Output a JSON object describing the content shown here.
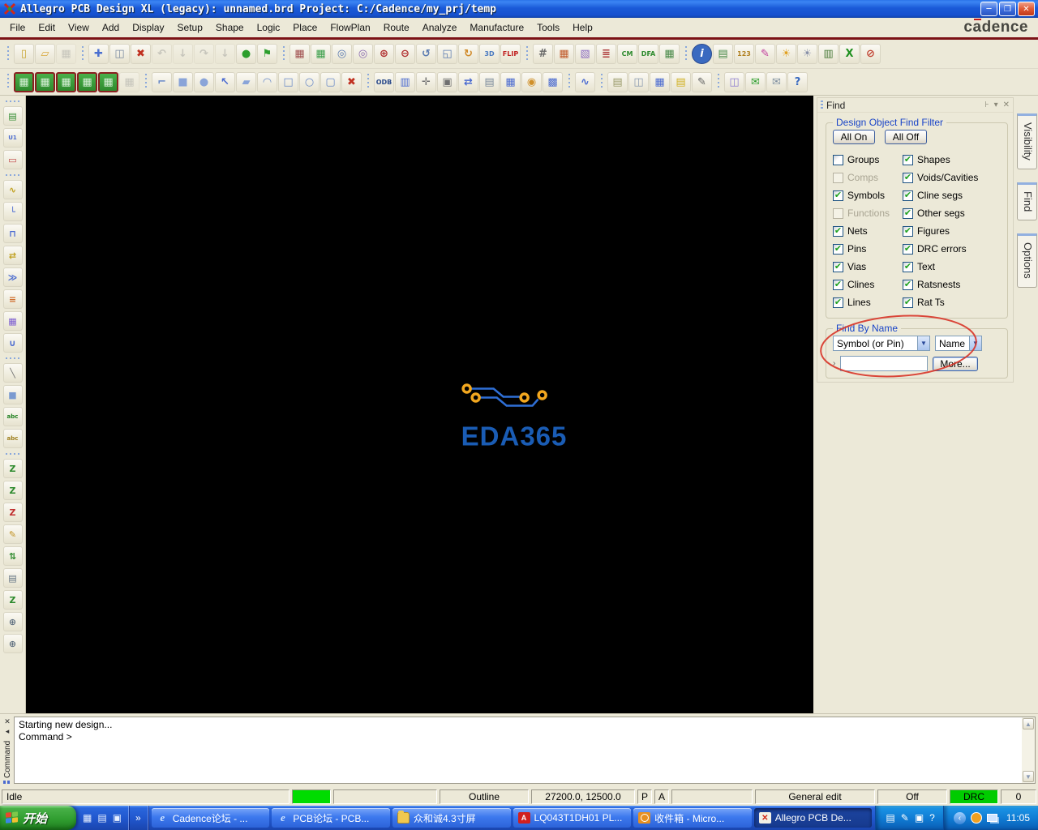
{
  "window": {
    "title": "Allegro PCB Design XL (legacy): unnamed.brd  Project: C:/Cadence/my_prj/temp"
  },
  "menubar": {
    "items": [
      {
        "n": "menu-file",
        "label": "File"
      },
      {
        "n": "menu-edit",
        "label": "Edit"
      },
      {
        "n": "menu-view",
        "label": "View"
      },
      {
        "n": "menu-add",
        "label": "Add"
      },
      {
        "n": "menu-display",
        "label": "Display"
      },
      {
        "n": "menu-setup",
        "label": "Setup"
      },
      {
        "n": "menu-shape",
        "label": "Shape"
      },
      {
        "n": "menu-logic",
        "label": "Logic"
      },
      {
        "n": "menu-place",
        "label": "Place"
      },
      {
        "n": "menu-flowplan",
        "label": "FlowPlan"
      },
      {
        "n": "menu-route",
        "label": "Route"
      },
      {
        "n": "menu-analyze",
        "label": "Analyze"
      },
      {
        "n": "menu-manufacture",
        "label": "Manufacture"
      },
      {
        "n": "menu-tools",
        "label": "Tools"
      },
      {
        "n": "menu-help",
        "label": "Help"
      }
    ],
    "brand": {
      "pre": "c",
      "a": "a",
      "post": "dence"
    }
  },
  "toolbar_top": [
    {
      "sep": true
    },
    {
      "n": "new-file-icon",
      "g": "▯",
      "c": "#c8a430"
    },
    {
      "n": "open-folder-icon",
      "g": "▱",
      "c": "#d8a83a"
    },
    {
      "n": "save-icon",
      "g": "▦",
      "c": "#9a9a9a",
      "cls": "dis"
    },
    {
      "sep": true
    },
    {
      "n": "move-icon",
      "g": "✚",
      "c": "#4a6fd0"
    },
    {
      "n": "copy-icon",
      "g": "◫",
      "c": "#7a8aa0"
    },
    {
      "n": "delete-icon",
      "g": "✖",
      "c": "#c03020"
    },
    {
      "n": "undo-icon",
      "g": "↶",
      "c": "#9a9a9a",
      "cls": "dis"
    },
    {
      "n": "export-icon",
      "g": "↓",
      "c": "#9a9a9a",
      "cls": "dis"
    },
    {
      "n": "redo-icon",
      "g": "↷",
      "c": "#9a9a9a",
      "cls": "dis"
    },
    {
      "n": "import-icon",
      "g": "↓",
      "c": "#9a9a9a",
      "cls": "dis"
    },
    {
      "n": "world-view-icon",
      "g": "●",
      "c": "#2d9e2d"
    },
    {
      "n": "pin-view-icon",
      "g": "⚑",
      "c": "#2d9e2d"
    },
    {
      "sep": true
    },
    {
      "n": "redraw-icon",
      "g": "▦",
      "c": "#a05050"
    },
    {
      "n": "zoom-world-icon",
      "g": "▦",
      "c": "#3a9e4a"
    },
    {
      "n": "zoom-rect-icon",
      "g": "◎",
      "c": "#5a7ab0"
    },
    {
      "n": "zoom-points-icon",
      "g": "◎",
      "c": "#8a6ab0"
    },
    {
      "n": "zoom-in-icon",
      "g": "⊕",
      "c": "#b03030"
    },
    {
      "n": "zoom-out-icon",
      "g": "⊖",
      "c": "#b03030"
    },
    {
      "n": "zoom-previous-icon",
      "g": "↺",
      "c": "#5a7ab0"
    },
    {
      "n": "zoom-fit-icon",
      "g": "◱",
      "c": "#5a7ab0"
    },
    {
      "n": "zoom-redraw-icon",
      "g": "↻",
      "c": "#d08a2a"
    },
    {
      "n": "view-3d-icon",
      "g": "3D",
      "c": "#4a7ac0",
      "cls": "txt"
    },
    {
      "n": "flip-design-icon",
      "g": "FLIP",
      "c": "#c02020",
      "cls": "txt"
    },
    {
      "sep": true
    },
    {
      "n": "grid-toggle-icon",
      "g": "#",
      "c": "#6a6a6a"
    },
    {
      "n": "color-dialog-icon",
      "g": "▦",
      "c": "#c05a2a"
    },
    {
      "n": "color-priority-icon",
      "g": "▧",
      "c": "#8a6ac0"
    },
    {
      "n": "shadow-mode-icon",
      "g": "≣",
      "c": "#b04040"
    },
    {
      "n": "cm-view-icon",
      "g": "CM",
      "c": "#2d8a2d",
      "cls": "txt"
    },
    {
      "n": "dfa-view-icon",
      "g": "DFA",
      "c": "#2d8a2d",
      "cls": "txt"
    },
    {
      "n": "status-sheet-icon",
      "g": "▦",
      "c": "#4a8a4a"
    },
    {
      "sep": true
    },
    {
      "n": "info-icon",
      "g": "i",
      "c": "#ffffff",
      "cls": "badge"
    },
    {
      "n": "properties-icon",
      "g": "▤",
      "c": "#4a8a4a"
    },
    {
      "n": "measure-icon",
      "g": "123",
      "c": "#b08020",
      "cls": "txt"
    },
    {
      "n": "brush-icon",
      "g": "✎",
      "c": "#c03a9a"
    },
    {
      "n": "shadow-on-icon",
      "g": "☀",
      "c": "#e0a020"
    },
    {
      "n": "shadow-dim-icon",
      "g": "☀",
      "c": "#8890a8"
    },
    {
      "n": "blinds-icon",
      "g": "▥",
      "c": "#4a7a3a"
    },
    {
      "n": "hourglass-icon",
      "g": "X",
      "c": "#209020"
    },
    {
      "n": "no-action-icon",
      "g": "⊘",
      "c": "#c04030"
    }
  ],
  "toolbar_second": [
    {
      "sep": true
    },
    {
      "n": "board-new-icon",
      "g": "▦",
      "c": "#d8f0d8",
      "cls": "board"
    },
    {
      "n": "board-open-icon",
      "g": "▦",
      "c": "#d8f0d8",
      "cls": "board"
    },
    {
      "n": "board-route-icon",
      "g": "▦",
      "c": "#d8f0d8",
      "cls": "board"
    },
    {
      "n": "board-refresh-icon",
      "g": "▦",
      "c": "#d8f0d8",
      "cls": "board"
    },
    {
      "n": "board-shape-icon",
      "g": "▦",
      "c": "#d8f0d8",
      "cls": "board"
    },
    {
      "n": "board-disabled-icon",
      "g": "▦",
      "c": "#9a9a9a",
      "cls": "dis"
    },
    {
      "sep": true
    },
    {
      "n": "add-line-seg-icon",
      "g": "⌐",
      "c": "#6a8ac8"
    },
    {
      "n": "add-rect-fill-icon",
      "g": "■",
      "c": "#8aa4d8"
    },
    {
      "n": "add-circle-fill-icon",
      "g": "●",
      "c": "#8aa4d8"
    },
    {
      "n": "select-tool-icon",
      "g": "↖",
      "c": "#4a6ad0"
    },
    {
      "n": "add-poly-icon",
      "g": "▰",
      "c": "#8aa4d8"
    },
    {
      "n": "add-arc-icon",
      "g": "◠",
      "c": "#6a8ac8"
    },
    {
      "n": "add-rect-icon",
      "g": "□",
      "c": "#6a8ac8"
    },
    {
      "n": "add-circle-icon",
      "g": "○",
      "c": "#6a8ac8"
    },
    {
      "n": "dashed-rect-icon",
      "g": "▢",
      "c": "#6a8ac8"
    },
    {
      "n": "delete-shape-icon",
      "g": "✖",
      "c": "#c03020"
    },
    {
      "sep": true
    },
    {
      "n": "odb-export-icon",
      "g": "ODB",
      "c": "#2a4a8a",
      "cls": "txt"
    },
    {
      "n": "layers-icon",
      "g": "▥",
      "c": "#4a6ad0"
    },
    {
      "n": "wrench-icon",
      "g": "✛",
      "c": "#707070"
    },
    {
      "n": "camera-icon",
      "g": "▣",
      "c": "#707070"
    },
    {
      "n": "swap-ref-icon",
      "g": "⇄",
      "c": "#4a6ad0"
    },
    {
      "n": "notes-icon",
      "g": "▤",
      "c": "#7a8a9a"
    },
    {
      "n": "pattern-grid-icon",
      "g": "▦",
      "c": "#4a6ad0"
    },
    {
      "n": "testpoint-icon",
      "g": "◉",
      "c": "#d0902a"
    },
    {
      "n": "array-icon",
      "g": "▩",
      "c": "#4a6ad0"
    },
    {
      "sep": true
    },
    {
      "n": "waveform-icon",
      "g": "∿",
      "c": "#4a6ad0"
    },
    {
      "sep": true
    },
    {
      "n": "report-icon",
      "g": "▤",
      "c": "#9a9a6a"
    },
    {
      "n": "manual-icon",
      "g": "◫",
      "c": "#8a9ab0"
    },
    {
      "n": "package-icon",
      "g": "▦",
      "c": "#4a6ad0"
    },
    {
      "n": "check-note-icon",
      "g": "▤",
      "c": "#d0b020"
    },
    {
      "n": "markup-pen-icon",
      "g": "✎",
      "c": "#606060"
    },
    {
      "sep": true
    },
    {
      "n": "copy-view-icon",
      "g": "◫",
      "c": "#8a7ad0"
    },
    {
      "n": "mail-send-icon",
      "g": "✉",
      "c": "#2d9e2d"
    },
    {
      "n": "mail-icon",
      "g": "✉",
      "c": "#8090a0"
    },
    {
      "n": "help-icon",
      "g": "?",
      "c": "#3a6ac0"
    }
  ],
  "left_toolbar": [
    {
      "sep": true
    },
    {
      "n": "import-logic-icon",
      "g": "▤",
      "c": "#2d8a2d"
    },
    {
      "n": "footprint-symbol-icon",
      "g": "U1",
      "c": "#4a6ad0",
      "cls": "txt"
    },
    {
      "n": "padstack-icon",
      "g": "▭",
      "c": "#c04040"
    },
    {
      "sep": true
    },
    {
      "n": "add-connect-icon",
      "g": "∿",
      "c": "#c0a020"
    },
    {
      "n": "route-corner-icon",
      "g": "└",
      "c": "#4a6ad0"
    },
    {
      "n": "route-meander-icon",
      "g": "⊓",
      "c": "#4a6ad0"
    },
    {
      "n": "pin-to-pin-icon",
      "g": "⇄",
      "c": "#c0a020"
    },
    {
      "n": "fanout-icon",
      "g": "≫",
      "c": "#4a6ad0"
    },
    {
      "n": "bundle-route-icon",
      "g": "≡",
      "c": "#d07030"
    },
    {
      "n": "pattern-route-icon",
      "g": "▦",
      "c": "#7a5ad0"
    },
    {
      "n": "snake-route-icon",
      "g": "∪",
      "c": "#4a6ad0"
    },
    {
      "sep": true
    },
    {
      "n": "add-line-icon",
      "g": "╲",
      "c": "#707070"
    },
    {
      "n": "add-rect-shape-icon",
      "g": "■",
      "c": "#7a9ad0"
    },
    {
      "n": "add-text-icon",
      "g": "abc",
      "c": "#208020",
      "cls": "txt"
    },
    {
      "n": "edit-text-icon",
      "g": "abc",
      "c": "#a08020",
      "cls": "txt"
    },
    {
      "sep": true
    },
    {
      "n": "slide-etch-icon",
      "g": "Z",
      "c": "#2d8a2d"
    },
    {
      "n": "delay-tune-icon",
      "g": "Z",
      "c": "#2d8a2d"
    },
    {
      "n": "delete-segment-icon",
      "g": "Z",
      "c": "#c03030"
    },
    {
      "n": "edit-vertex-icon",
      "g": "✎",
      "c": "#c09020"
    },
    {
      "n": "update-symbol-icon",
      "g": "⇅",
      "c": "#2d8a2d"
    },
    {
      "n": "drawing-record-icon",
      "g": "▤",
      "c": "#607080"
    },
    {
      "n": "net-tune-icon",
      "g": "Z",
      "c": "#2d8a2d"
    },
    {
      "n": "via-top-icon",
      "g": "⊕",
      "c": "#607080"
    },
    {
      "n": "via-bottom-icon",
      "g": "⊕",
      "c": "#607080"
    }
  ],
  "canvas": {
    "logo_text": "EDA365"
  },
  "find_panel": {
    "title": "Find",
    "filter": {
      "title": "Design Object Find Filter",
      "all_on": "All On",
      "all_off": "All Off",
      "left": [
        {
          "n": "checkbox-groups",
          "label": "Groups",
          "cls": "off"
        },
        {
          "n": "checkbox-comps",
          "label": "Comps",
          "cls": "dis"
        },
        {
          "n": "checkbox-symbols",
          "label": "Symbols",
          "cls": "on"
        },
        {
          "n": "checkbox-functions",
          "label": "Functions",
          "cls": "dis"
        },
        {
          "n": "checkbox-nets",
          "label": "Nets",
          "cls": "on"
        },
        {
          "n": "checkbox-pins",
          "label": "Pins",
          "cls": "on"
        },
        {
          "n": "checkbox-vias",
          "label": "Vias",
          "cls": "on"
        },
        {
          "n": "checkbox-clines",
          "label": "Clines",
          "cls": "on"
        },
        {
          "n": "checkbox-lines",
          "label": "Lines",
          "cls": "on"
        }
      ],
      "right": [
        {
          "n": "checkbox-shapes",
          "label": "Shapes",
          "cls": "on"
        },
        {
          "n": "checkbox-voids",
          "label": "Voids/Cavities",
          "cls": "on"
        },
        {
          "n": "checkbox-cline-segs",
          "label": "Cline segs",
          "cls": "on"
        },
        {
          "n": "checkbox-other-segs",
          "label": "Other segs",
          "cls": "on"
        },
        {
          "n": "checkbox-figures",
          "label": "Figures",
          "cls": "on"
        },
        {
          "n": "checkbox-drc-errors",
          "label": "DRC errors",
          "cls": "on"
        },
        {
          "n": "checkbox-text",
          "label": "Text",
          "cls": "on"
        },
        {
          "n": "checkbox-ratsnests",
          "label": "Ratsnests",
          "cls": "on"
        },
        {
          "n": "checkbox-rat-ts",
          "label": "Rat Ts",
          "cls": "on"
        }
      ]
    },
    "by_name": {
      "title": "Find By Name",
      "type_value": "Symbol (or Pin)",
      "mode_value": "Name",
      "input_value": "",
      "more": "More..."
    }
  },
  "side_tabs": [
    {
      "n": "tab-visibility",
      "label": "Visibility"
    },
    {
      "n": "tab-find",
      "label": "Find"
    },
    {
      "n": "tab-options",
      "label": "Options"
    }
  ],
  "command_panel": {
    "label": "Command",
    "lines": [
      {
        "n": "command-line",
        "text": "Starting new design..."
      },
      {
        "n": "command-prompt",
        "text": "Command >"
      }
    ]
  },
  "status_bar": {
    "idle": "Idle",
    "outline": "Outline",
    "coords": "27200.0, 12500.0",
    "p": "P",
    "a": "A",
    "edit": "General edit",
    "off": "Off",
    "drc": "DRC",
    "count": "0"
  },
  "taskbar": {
    "start": "开始",
    "quicklaunch": [
      {
        "n": "quicklaunch-desktop-icon",
        "g": "▦"
      },
      {
        "n": "quicklaunch-media-icon",
        "g": "▤"
      },
      {
        "n": "quicklaunch-device-icon",
        "g": "▣"
      }
    ],
    "overflow": "»",
    "tasks": [
      {
        "n": "task-cadence-forum",
        "label": "Cadence论坛 - ...",
        "icon": "ie"
      },
      {
        "n": "task-pcb-forum",
        "label": "PCB论坛 - PCB...",
        "icon": "ie"
      },
      {
        "n": "task-folder",
        "label": "众和诚4.3寸屏",
        "icon": "folder"
      },
      {
        "n": "task-pdf",
        "label": "LQ043T1DH01 PL...",
        "icon": "pdf"
      },
      {
        "n": "task-inbox",
        "label": "收件箱 - Micro...",
        "icon": "mail"
      },
      {
        "n": "task-allegro",
        "label": "Allegro PCB De...",
        "icon": "allegro",
        "cls": "active"
      }
    ],
    "band_icons": [
      {
        "n": "keyboard-icon",
        "g": "▤"
      },
      {
        "n": "pen-input-icon",
        "g": "✎"
      },
      {
        "n": "tablet-icon",
        "g": "▣"
      },
      {
        "n": "help-tray-icon",
        "g": "?"
      }
    ],
    "tray_icons": [
      {
        "n": "collapse-tray-icon",
        "g": "‹",
        "cls": "chev"
      },
      {
        "n": "clock-app-icon",
        "g": "",
        "cls": "clock"
      },
      {
        "n": "network-icon",
        "g": "",
        "cls": "net"
      }
    ],
    "time": "11:05"
  }
}
